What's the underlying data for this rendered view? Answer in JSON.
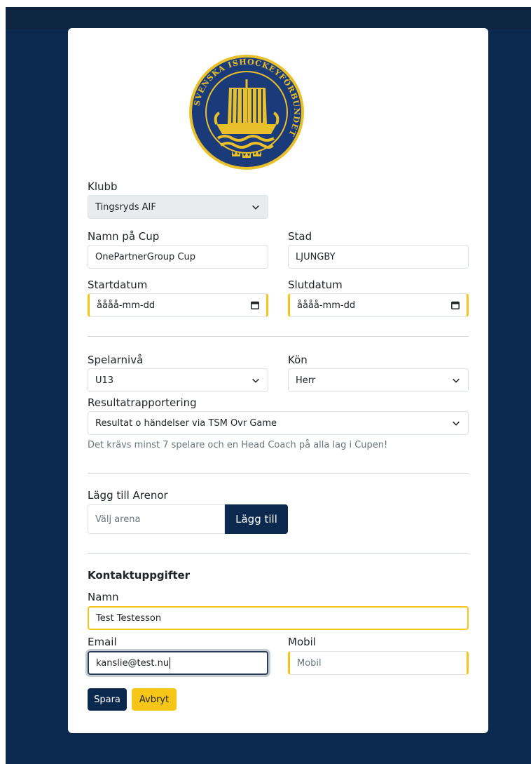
{
  "colors": {
    "navy": "#0b284e",
    "yellow": "#f5c518",
    "muted": "#6c757d"
  },
  "logo": {
    "ring_text": "SVENSKA ISHOCKEYFÖRBUNDET"
  },
  "form": {
    "klubb": {
      "label": "Klubb",
      "value": "Tingsryds AIF"
    },
    "cup_name": {
      "label": "Namn på Cup",
      "value": "OnePartnerGroup Cup"
    },
    "city": {
      "label": "Stad",
      "value": "LJUNGBY"
    },
    "start_date": {
      "label": "Startdatum",
      "placeholder": "åååå-mm-dd"
    },
    "end_date": {
      "label": "Slutdatum",
      "placeholder": "åååå-mm-dd"
    },
    "player_level": {
      "label": "Spelarnivå",
      "value": "U13"
    },
    "gender": {
      "label": "Kön",
      "value": "Herr"
    },
    "reporting": {
      "label": "Resultatrapportering",
      "value": "Resultat o händelser via TSM Ovr Game"
    },
    "requirement_note": "Det krävs minst 7 spelare och en Head Coach på alla lag i Cupen!",
    "arenas": {
      "label": "Lägg till Arenor",
      "placeholder": "Välj arena",
      "add_button": "Lägg till"
    },
    "contact": {
      "heading": "Kontaktuppgifter",
      "name": {
        "label": "Namn",
        "value": "Test Testesson"
      },
      "email": {
        "label": "Email",
        "value": "kanslie@test.nu"
      },
      "mobile": {
        "label": "Mobil",
        "placeholder": "Mobil"
      }
    },
    "save_button": "Spara",
    "cancel_button": "Avbryt"
  }
}
